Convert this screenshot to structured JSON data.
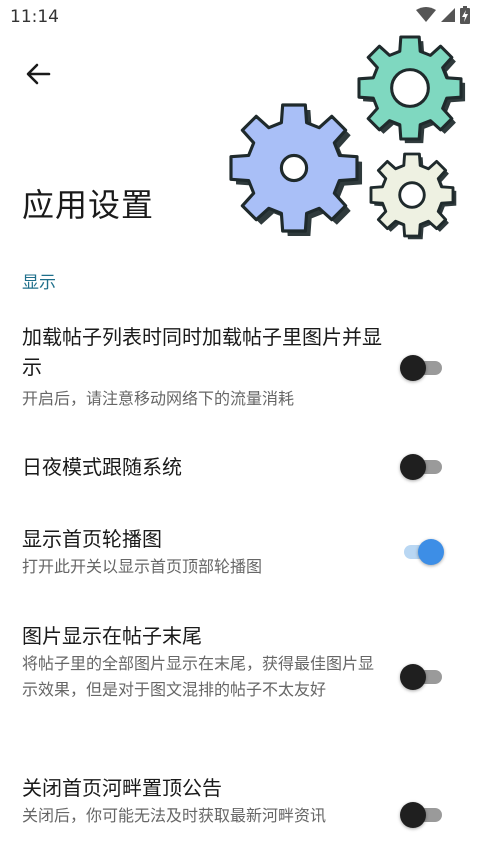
{
  "status_bar": {
    "time": "11:14"
  },
  "header": {
    "title": "应用设置",
    "back_icon": "arrow-left-icon",
    "illustration_icon": "gears-icon"
  },
  "section": {
    "title": "显示"
  },
  "settings": [
    {
      "title": "加载帖子列表时同时加载帖子里图片并显示",
      "desc": "开启后，请注意移动网络下的流量消耗",
      "enabled": false
    },
    {
      "title": "日夜模式跟随系统",
      "desc": "",
      "enabled": false
    },
    {
      "title": "显示首页轮播图",
      "desc": "打开此开关以显示首页顶部轮播图",
      "enabled": true
    },
    {
      "title": "图片显示在帖子末尾",
      "desc": "将帖子里的全部图片显示在末尾，获得最佳图片显示效果，但是对于图文混排的帖子不太友好",
      "enabled": false
    },
    {
      "title": "关闭首页河畔置顶公告",
      "desc": "关闭后，你可能无法及时获取最新河畔资讯",
      "enabled": false
    }
  ],
  "colors": {
    "accent": "#3d8ee6",
    "section_header": "#1f6f8b",
    "gear_blue": "#a9bff7",
    "gear_green": "#7fd8c0",
    "gear_cream": "#eef1e2"
  }
}
